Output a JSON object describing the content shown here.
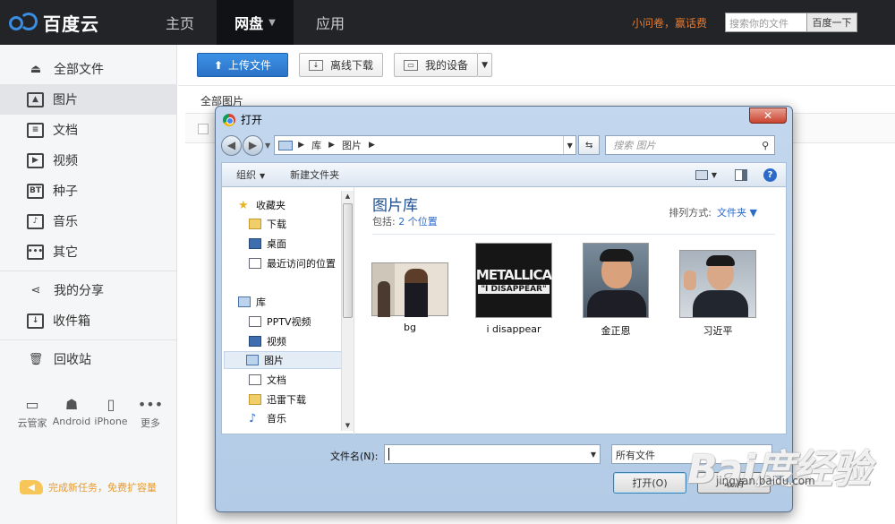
{
  "app": {
    "logo_text": "百度云",
    "nav": [
      {
        "label": "主页"
      },
      {
        "label": "网盘",
        "active": true
      },
      {
        "label": "应用"
      }
    ],
    "promo": "小问卷，赢话费",
    "search_placeholder": "搜索你的文件",
    "search_button": "百度一下"
  },
  "sidebar": {
    "items": [
      {
        "label": "全部文件",
        "icon": "cloud-upload-icon"
      },
      {
        "label": "图片",
        "icon": "image-icon",
        "active": true
      },
      {
        "label": "文档",
        "icon": "document-icon"
      },
      {
        "label": "视频",
        "icon": "video-icon"
      },
      {
        "label": "种子",
        "icon": "bt-icon",
        "glyph": "BT"
      },
      {
        "label": "音乐",
        "icon": "music-icon"
      },
      {
        "label": "其它",
        "icon": "more-box-icon"
      },
      {
        "label": "我的分享",
        "icon": "share-icon"
      },
      {
        "label": "收件箱",
        "icon": "inbox-icon"
      },
      {
        "label": "回收站",
        "icon": "trash-icon"
      }
    ],
    "devices": [
      {
        "label": "云管家",
        "icon": "monitor-icon"
      },
      {
        "label": "Android",
        "icon": "android-icon"
      },
      {
        "label": "iPhone",
        "icon": "phone-icon"
      },
      {
        "label": "更多",
        "icon": "more-icon"
      }
    ],
    "task_promo": "完成新任务，免费扩容量"
  },
  "toolbar": {
    "upload": "上传文件",
    "offline": "离线下载",
    "devices": "我的设备"
  },
  "breadcrumb": "全部图片",
  "dialog": {
    "title": "打开",
    "close": "✕",
    "address": [
      "库",
      "图片"
    ],
    "search_placeholder": "搜索 图片",
    "organize": "组织",
    "new_folder": "新建文件夹",
    "tree": {
      "favorites": "收藏夹",
      "download": "下载",
      "desktop": "桌面",
      "recent": "最近访问的位置",
      "libraries": "库",
      "pptv": "PPTV视频",
      "video": "视频",
      "pictures": "图片",
      "documents": "文档",
      "xunlei": "迅雷下载",
      "music": "音乐"
    },
    "library_title": "图片库",
    "library_includes": "包括:",
    "library_locations": "2 个位置",
    "arrange_label": "排列方式:",
    "arrange_value": "文件夹",
    "files": [
      {
        "name": "bg"
      },
      {
        "name": "i disappear"
      },
      {
        "name": "金正恩"
      },
      {
        "name": "习近平"
      }
    ],
    "metallica_line1": "METALLICA",
    "metallica_line2": "\"I DISAPPEAR\"",
    "filename_label": "文件名(N):",
    "filename_value": "",
    "filetype": "所有文件",
    "open": "打开(O)",
    "cancel": "取消"
  },
  "watermark": {
    "text": "Bai度经验",
    "url": "jingyan.baidu.com"
  }
}
